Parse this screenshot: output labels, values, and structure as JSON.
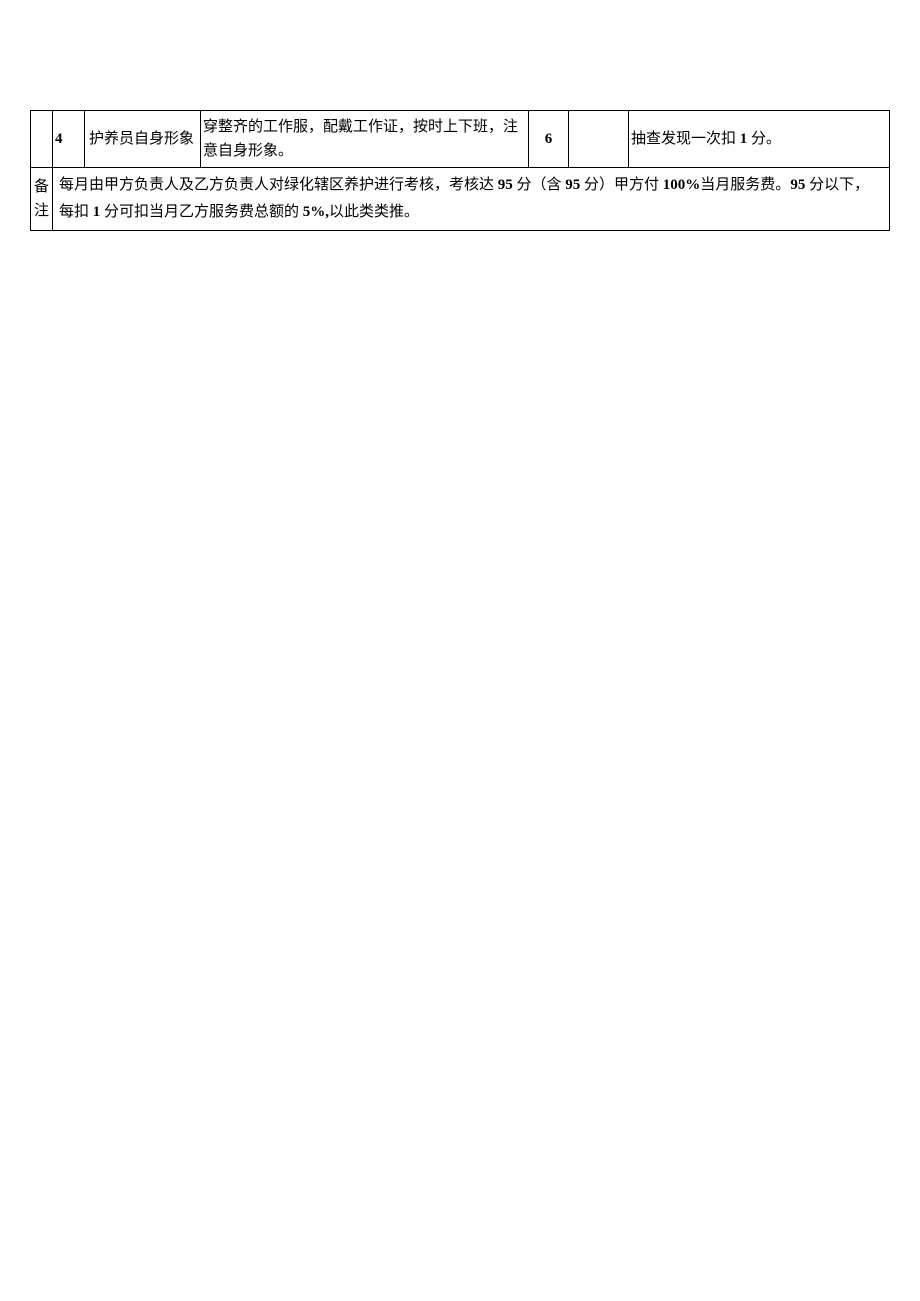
{
  "rows": [
    {
      "num": "4",
      "item": "护养员自身形象",
      "desc_part1": "穿整齐的工作服，配戴工作证，按时上下班，注意自身形象。",
      "score": "6",
      "blank": "",
      "deduction": "抽查发现一次扣 ",
      "deduction_num": "1",
      "deduction_tail": " 分。"
    }
  ],
  "note": {
    "label": "备注",
    "text_p1": "每月由甲方负责人及乙方负责人对绿化辖区养护进行考核，考核达 ",
    "n95_1": "95",
    "text_p2": " 分（含 ",
    "n95_2": "95",
    "text_p3": " 分）甲方付 ",
    "n100": "100%",
    "text_p4": "当月服务费。",
    "n95_3": "95",
    "text_p5": " 分以下，每扣 ",
    "n1": "1",
    "text_p6": " 分可扣当月乙方服务费总额的 ",
    "n5": "5%,",
    "text_p7": "以此类类推。"
  }
}
